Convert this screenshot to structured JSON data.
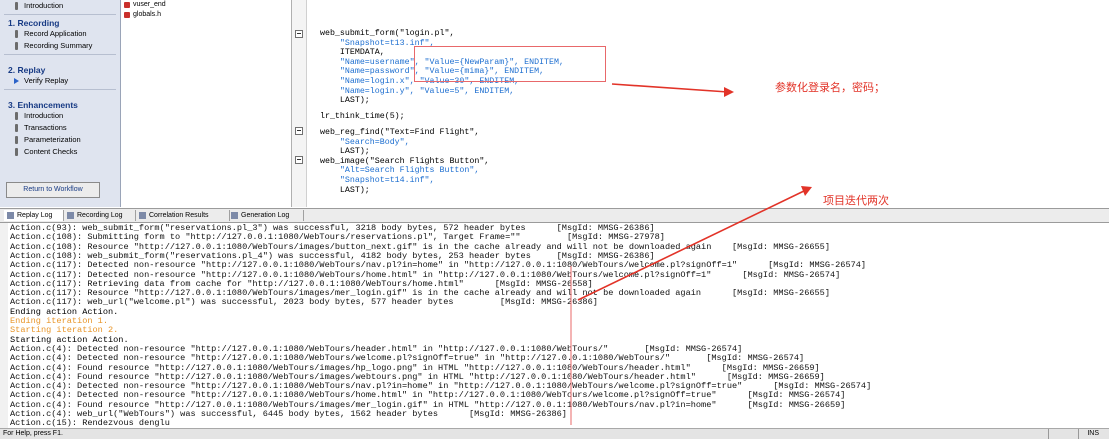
{
  "sidebar": {
    "intro_item": "Introduction",
    "sections": [
      {
        "title": "1. Recording",
        "items": [
          "Record Application",
          "Recording Summary"
        ]
      },
      {
        "title": "2. Replay",
        "items": [
          "Verify Replay"
        ]
      },
      {
        "title": "3. Enhancements",
        "items": [
          "Introduction",
          "Transactions",
          "Parameterization",
          "Content Checks"
        ]
      }
    ],
    "workflow_button": "Return to Workflow"
  },
  "files": [
    "vuser_end",
    "globals.h"
  ],
  "editor": {
    "lines": [
      "web_submit_form(\"login.pl\",",
      "    \"Snapshot=t13.inf\",",
      "    ITEMDATA,",
      "    \"Name=username\", \"Value={NewParam}\", ENDITEM,",
      "    \"Name=password\", \"Value={mima}\", ENDITEM,",
      "    \"Name=login.x\", \"Value=30\", ENDITEM,",
      "    \"Name=login.y\", \"Value=5\", ENDITEM,",
      "    LAST);",
      "",
      "lr_think_time(5);",
      "",
      "web_reg_find(\"Text=Find Flight\",",
      "    \"Search=Body\",",
      "    LAST);",
      "web_image(\"Search Flights Button\",",
      "    \"Alt=Search Flights Button\",",
      "    \"Snapshot=t14.inf\",",
      "    LAST);"
    ]
  },
  "annotations": {
    "note1": "参数化登录名，密码；",
    "note2": "项目迭代两次"
  },
  "tabs": [
    "Replay Log",
    "Recording Log",
    "Correlation Results",
    "Generation Log"
  ],
  "log": [
    {
      "text": "Action.c(93): web_submit_form(\"reservations.pl_3\") was successful, 3218 body bytes, 572 header bytes      [MsgId: MMSG-26386]",
      "kind": "green"
    },
    {
      "text": "Action.c(108): Submitting form to \"http://127.0.0.1:1080/WebTours/reservations.pl\", Target Frame=\"\"         [MsgId: MMSG-27978]",
      "kind": "green"
    },
    {
      "text": "Action.c(108): Resource \"http://127.0.0.1:1080/WebTours/images/button_next.gif\" is in the cache already and will not be downloaded again    [MsgId: MMSG-26655]",
      "kind": "green"
    },
    {
      "text": "Action.c(108): web_submit_form(\"reservations.pl_4\") was successful, 4182 body bytes, 253 header bytes     [MsgId: MMSG-26386]",
      "kind": "green"
    },
    {
      "text": "Action.c(117): Detected non-resource \"http://127.0.0.1:1080/WebTours/nav.pl?in=home\" in \"http://127.0.0.1:1080/WebTours/welcome.pl?signOff=1\"      [MsgId: MMSG-26574]",
      "kind": "green"
    },
    {
      "text": "Action.c(117): Detected non-resource \"http://127.0.0.1:1080/WebTours/home.html\" in \"http://127.0.0.1:1080/WebTours/welcome.pl?signOff=1\"      [MsgId: MMSG-26574]",
      "kind": "green"
    },
    {
      "text": "Action.c(117): Retrieving data from cache for \"http://127.0.0.1:1080/WebTours/home.html\"      [MsgId: MMSG-26558]",
      "kind": "green"
    },
    {
      "text": "Action.c(117): Resource \"http://127.0.0.1:1080/WebTours/images/mer_login.gif\" is in the cache already and will not be downloaded again      [MsgId: MMSG-26655]",
      "kind": "green"
    },
    {
      "text": "Action.c(117): web_url(\"welcome.pl\") was successful, 2023 body bytes, 577 header bytes         [MsgId: MMSG-26386]",
      "kind": "green"
    },
    {
      "text": "Ending action Action.",
      "kind": "black"
    },
    {
      "text": "Ending iteration 1.",
      "kind": "orange"
    },
    {
      "text": "Starting iteration 2.",
      "kind": "orange"
    },
    {
      "text": "Starting action Action.",
      "kind": "black"
    },
    {
      "text": "Action.c(4): Detected non-resource \"http://127.0.0.1:1080/WebTours/header.html\" in \"http://127.0.0.1:1080/WebTours/\"       [MsgId: MMSG-26574]",
      "kind": "green"
    },
    {
      "text": "Action.c(4): Detected non-resource \"http://127.0.0.1:1080/WebTours/welcome.pl?signOff=true\" in \"http://127.0.0.1:1080/WebTours/\"       [MsgId: MMSG-26574]",
      "kind": "green"
    },
    {
      "text": "Action.c(4): Found resource \"http://127.0.0.1:1080/WebTours/images/hp_logo.png\" in HTML \"http://127.0.0.1:1080/WebTours/header.html\"      [MsgId: MMSG-26659]",
      "kind": "green"
    },
    {
      "text": "Action.c(4): Found resource \"http://127.0.0.1:1080/WebTours/images/webtours.png\" in HTML \"http://127.0.0.1:1080/WebTours/header.html\"      [MsgId: MMSG-26659]",
      "kind": "green"
    },
    {
      "text": "Action.c(4): Detected non-resource \"http://127.0.0.1:1080/WebTours/nav.pl?in=home\" in \"http://127.0.0.1:1080/WebTours/welcome.pl?signOff=true\"      [MsgId: MMSG-26574]",
      "kind": "green"
    },
    {
      "text": "Action.c(4): Detected non-resource \"http://127.0.0.1:1080/WebTours/home.html\" in \"http://127.0.0.1:1080/WebTours/welcome.pl?signOff=true\"      [MsgId: MMSG-26574]",
      "kind": "green"
    },
    {
      "text": "Action.c(4): Found resource \"http://127.0.0.1:1080/WebTours/images/mer_login.gif\" in HTML \"http://127.0.0.1:1080/WebTours/nav.pl?in=home\"      [MsgId: MMSG-26659]",
      "kind": "green"
    },
    {
      "text": "Action.c(4): web_url(\"WebTours\") was successful, 6445 body bytes, 1562 header bytes      [MsgId: MMSG-26386]",
      "kind": "green"
    },
    {
      "text": "Action.c(15): Rendezvous denglu",
      "kind": "green"
    }
  ],
  "status": {
    "text": "For Help, press F1.",
    "ins": "INS"
  },
  "colors": {
    "accent": "#173a84",
    "annotation": "#e23328",
    "orange_log": "#e8962a",
    "string": "#1e6fd0"
  }
}
